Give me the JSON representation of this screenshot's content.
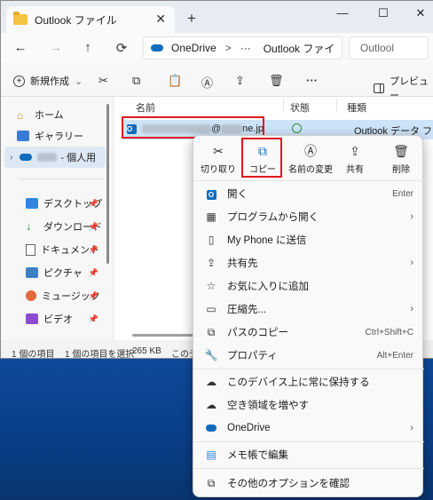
{
  "window": {
    "tab_title": "Outlook ファイル",
    "close_tab": "✕",
    "new_tab": "+",
    "minimize": "—",
    "maximize": "☐",
    "close": "✕"
  },
  "address": {
    "back": "←",
    "forward": "→",
    "up": "↑",
    "refresh": "⟳",
    "root": "OneDrive",
    "sep": ">",
    "ellipsis": "···",
    "current": "Outlook ファイ",
    "search_placeholder": "Outlool"
  },
  "toolbar": {
    "new_label": "新規作成",
    "new_arrow": "⌄",
    "cut": "✂",
    "copy": "⧉",
    "paste": "📋",
    "rename": "Ⓐ",
    "share": "⇪",
    "delete": "🗑",
    "more": "···",
    "preview_label": "プレビュー"
  },
  "sidebar": {
    "items": [
      {
        "label": "ホーム"
      },
      {
        "label": "ギャラリー"
      },
      {
        "label": "- 個人用"
      },
      {
        "label": "デスクトップ"
      },
      {
        "label": "ダウンロード"
      },
      {
        "label": "ドキュメント"
      },
      {
        "label": "ピクチャ"
      },
      {
        "label": "ミュージック"
      },
      {
        "label": "ビデオ"
      }
    ],
    "pin": "📌"
  },
  "filelist": {
    "columns": {
      "name": "名前",
      "status": "状態",
      "type": "種類"
    },
    "row": {
      "name_suffix": "@",
      "name_end": "ne.jp",
      "type": "Outlook データ ファイル"
    }
  },
  "statusbar": {
    "count": "1 個の項目",
    "selected": "1 個の項目を選択",
    "size": "265 KB",
    "trail": "このデ"
  },
  "context_menu": {
    "actions": [
      {
        "icon": "✂",
        "label": "切り取り"
      },
      {
        "icon": "⧉",
        "label": "コピー"
      },
      {
        "icon": "Ⓐ",
        "label": "名前の変更"
      },
      {
        "icon": "⇪",
        "label": "共有"
      },
      {
        "icon": "🗑",
        "label": "削除"
      }
    ],
    "items": [
      {
        "label": "開く",
        "shortcut": "Enter"
      },
      {
        "label": "プログラムから開く",
        "arrow": "›"
      },
      {
        "label": "My Phone に送信"
      },
      {
        "label": "共有先",
        "arrow": "›"
      },
      {
        "label": "お気に入りに追加"
      },
      {
        "label": "圧縮先...",
        "arrow": "›"
      },
      {
        "label": "パスのコピー",
        "shortcut": "Ctrl+Shift+C"
      },
      {
        "label": "プロパティ",
        "shortcut": "Alt+Enter"
      },
      {
        "label": "このデバイス上に常に保持する"
      },
      {
        "label": "空き領域を増やす"
      },
      {
        "label": "OneDrive",
        "arrow": "›"
      },
      {
        "label": "メモ帳で編集"
      },
      {
        "label": "その他のオプションを確認"
      }
    ]
  },
  "colors": {
    "accent": "#0f6cbd",
    "highlight": "#e0191e",
    "selection": "#cde3f7",
    "desktop": "#0b3f86"
  }
}
